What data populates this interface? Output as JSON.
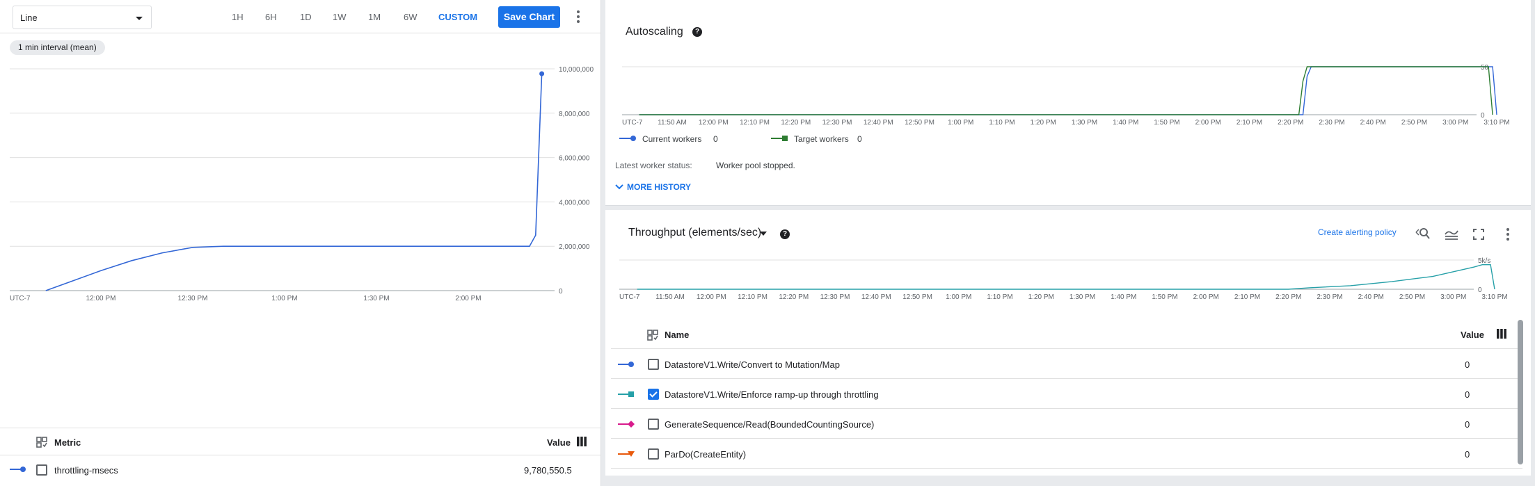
{
  "left": {
    "chart_type_select": "Line",
    "ranges": [
      "1H",
      "6H",
      "1D",
      "1W",
      "1M",
      "6W",
      "CUSTOM"
    ],
    "active_range": "CUSTOM",
    "save_label": "Save Chart",
    "interval_chip": "1 min interval (mean)",
    "legend": {
      "header_metric": "Metric",
      "header_value": "Value",
      "rows": [
        {
          "name": "throttling-msecs",
          "value": "9,780,550.5",
          "checked": false,
          "color": "#3367d6"
        }
      ]
    }
  },
  "autoscaling": {
    "title": "Autoscaling",
    "legend": [
      {
        "label": "Current workers",
        "value": "0",
        "color": "#3367d6"
      },
      {
        "label": "Target workers",
        "value": "0",
        "color": "#2e7d32"
      }
    ],
    "status_label": "Latest worker status:",
    "status_value": "Worker pool stopped.",
    "more_history": "MORE HISTORY"
  },
  "throughput": {
    "title": "Throughput (elements/sec)",
    "alert_link": "Create alerting policy",
    "table": {
      "header_name": "Name",
      "header_value": "Value",
      "rows": [
        {
          "name": "DatastoreV1.Write/Convert to Mutation/Map",
          "value": "0",
          "checked": false,
          "color": "#3367d6",
          "marker": "circle"
        },
        {
          "name": "DatastoreV1.Write/Enforce ramp-up through throttling",
          "value": "0",
          "checked": true,
          "color": "#26a0a8",
          "marker": "square"
        },
        {
          "name": "GenerateSequence/Read(BoundedCountingSource)",
          "value": "0",
          "checked": false,
          "color": "#d81b8c",
          "marker": "diamond"
        },
        {
          "name": "ParDo(CreateEntity)",
          "value": "0",
          "checked": false,
          "color": "#e8590c",
          "marker": "triangle"
        }
      ]
    }
  },
  "chart_data": [
    {
      "type": "line",
      "title": "",
      "x_ticks": [
        "UTC-7",
        "12:00 PM",
        "12:30 PM",
        "1:00 PM",
        "1:30 PM",
        "2:00 PM"
      ],
      "y_ticks": [
        "10,000,000",
        "8,000,000",
        "6,000,000",
        "4,000,000",
        "2,000,000",
        "0"
      ],
      "ylim": [
        0,
        10000000
      ],
      "grid": true,
      "series": [
        {
          "name": "throttling-msecs",
          "color": "#3367d6",
          "x": [
            "11:42 AM",
            "11:50 AM",
            "12:00 PM",
            "12:10 PM",
            "12:20 PM",
            "12:30 PM",
            "12:40 PM",
            "1:00 PM",
            "1:30 PM",
            "2:00 PM",
            "2:20 PM",
            "2:22 PM",
            "2:24 PM"
          ],
          "values": [
            0,
            400000,
            900000,
            1350000,
            1700000,
            1950000,
            2000000,
            2000000,
            2000000,
            2000000,
            2000000,
            2500000,
            9780550
          ]
        }
      ]
    },
    {
      "type": "line",
      "title": "Autoscaling",
      "x_ticks": [
        "UTC-7",
        "11:50 AM",
        "12:00 PM",
        "12:10 PM",
        "12:20 PM",
        "12:30 PM",
        "12:40 PM",
        "12:50 PM",
        "1:00 PM",
        "1:10 PM",
        "1:20 PM",
        "1:30 PM",
        "1:40 PM",
        "1:50 PM",
        "2:00 PM",
        "2:10 PM",
        "2:20 PM",
        "2:30 PM",
        "2:40 PM",
        "2:50 PM",
        "3:00 PM",
        "3:10 PM"
      ],
      "y_ticks": [
        "50",
        "0"
      ],
      "ylim": [
        0,
        50
      ],
      "grid": true,
      "series": [
        {
          "name": "Current workers",
          "color": "#3367d6",
          "x": [
            "11:42 AM",
            "2:23 PM",
            "2:24 PM",
            "2:25 PM",
            "3:09 PM",
            "3:10 PM"
          ],
          "values": [
            0,
            0,
            40,
            50,
            50,
            0
          ]
        },
        {
          "name": "Target workers",
          "color": "#2e7d32",
          "x": [
            "11:42 AM",
            "2:22 PM",
            "2:23 PM",
            "2:24 PM",
            "3:08 PM",
            "3:09 PM"
          ],
          "values": [
            0,
            0,
            35,
            50,
            50,
            0
          ]
        }
      ]
    },
    {
      "type": "line",
      "title": "Throughput (elements/sec)",
      "x_ticks": [
        "UTC-7",
        "11:50 AM",
        "12:00 PM",
        "12:10 PM",
        "12:20 PM",
        "12:30 PM",
        "12:40 PM",
        "12:50 PM",
        "1:00 PM",
        "1:10 PM",
        "1:20 PM",
        "1:30 PM",
        "1:40 PM",
        "1:50 PM",
        "2:00 PM",
        "2:10 PM",
        "2:20 PM",
        "2:30 PM",
        "2:40 PM",
        "2:50 PM",
        "3:00 PM",
        "3:10 PM"
      ],
      "y_ticks": [
        "5k/s",
        "0"
      ],
      "ylim": [
        0,
        5000
      ],
      "grid": true,
      "series": [
        {
          "name": "DatastoreV1.Write/Enforce ramp-up through throttling",
          "color": "#26a0a8",
          "x": [
            "11:42 AM",
            "2:20 PM",
            "2:25 PM",
            "2:35 PM",
            "2:45 PM",
            "2:55 PM",
            "3:00 PM",
            "3:05 PM",
            "3:07 PM",
            "3:09 PM",
            "3:10 PM"
          ],
          "values": [
            0,
            0,
            250,
            600,
            1300,
            2200,
            3000,
            3800,
            4200,
            4200,
            0
          ]
        }
      ]
    }
  ]
}
